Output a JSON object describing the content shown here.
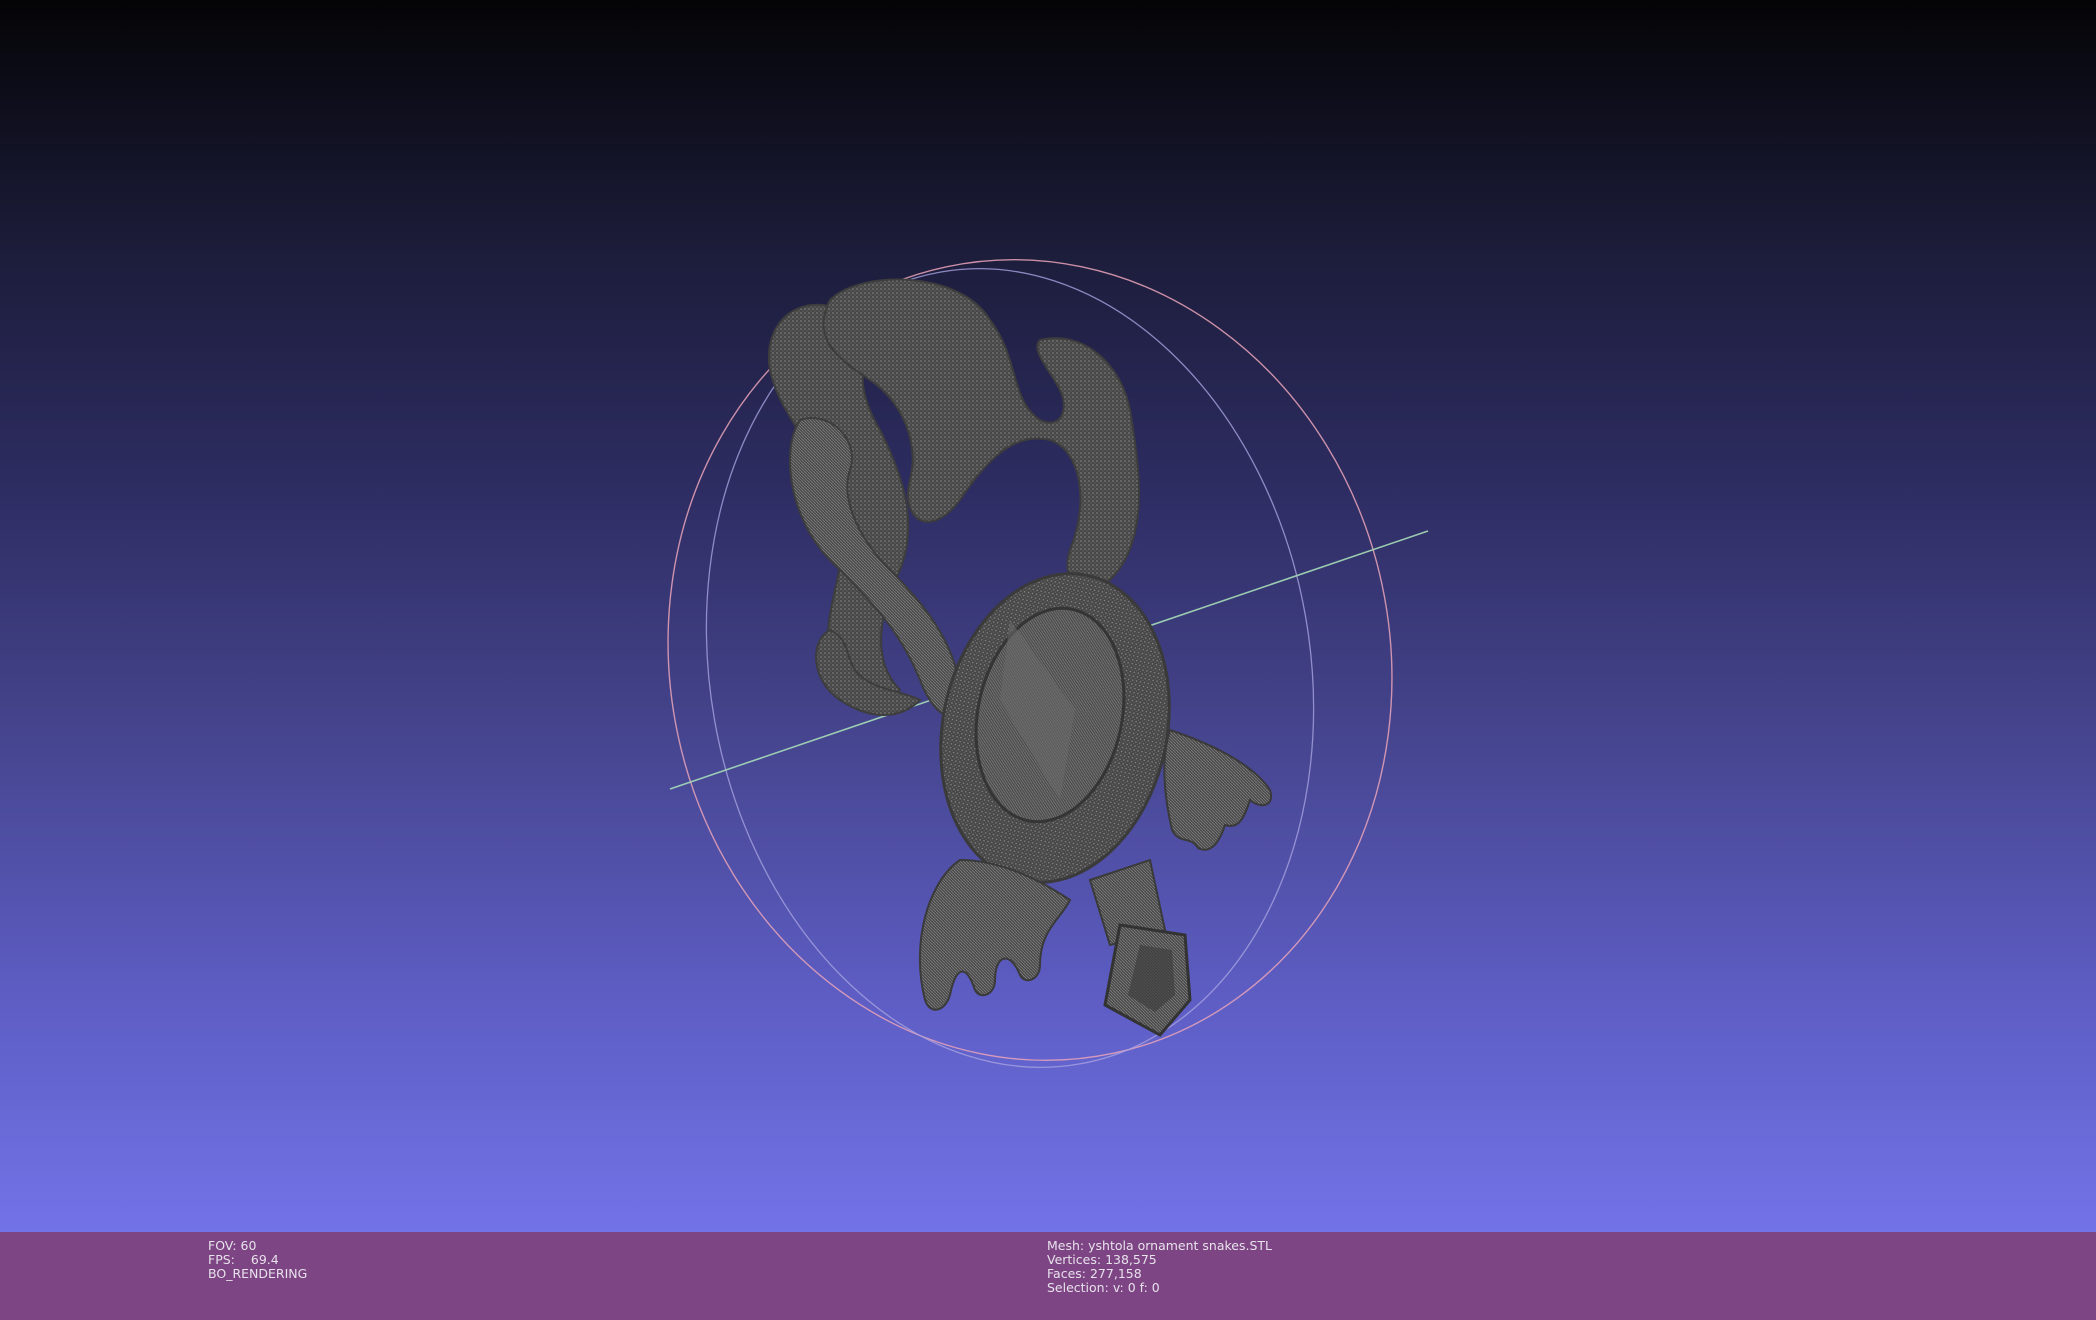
{
  "render_info": {
    "fov_label": "FOV:",
    "fov_value": "60",
    "fps_label": "FPS:",
    "fps_value": "69.4",
    "render_mode": "BO_RENDERING"
  },
  "mesh_info": {
    "mesh_label": "Mesh:",
    "mesh_name": "yshtola ornament snakes.STL",
    "vertices_label": "Vertices:",
    "vertices_value": "138,575",
    "faces_label": "Faces:",
    "faces_value": "277,158",
    "selection_label": "Selection:",
    "selection_value": "v: 0 f: 0"
  },
  "colors": {
    "status_bar": "#7d4583",
    "mesh": "#4a4a4a",
    "trackball_green": "#9fd6b0",
    "trackball_red": "#e79ab0",
    "trackball_blue": "#9b95d6"
  }
}
